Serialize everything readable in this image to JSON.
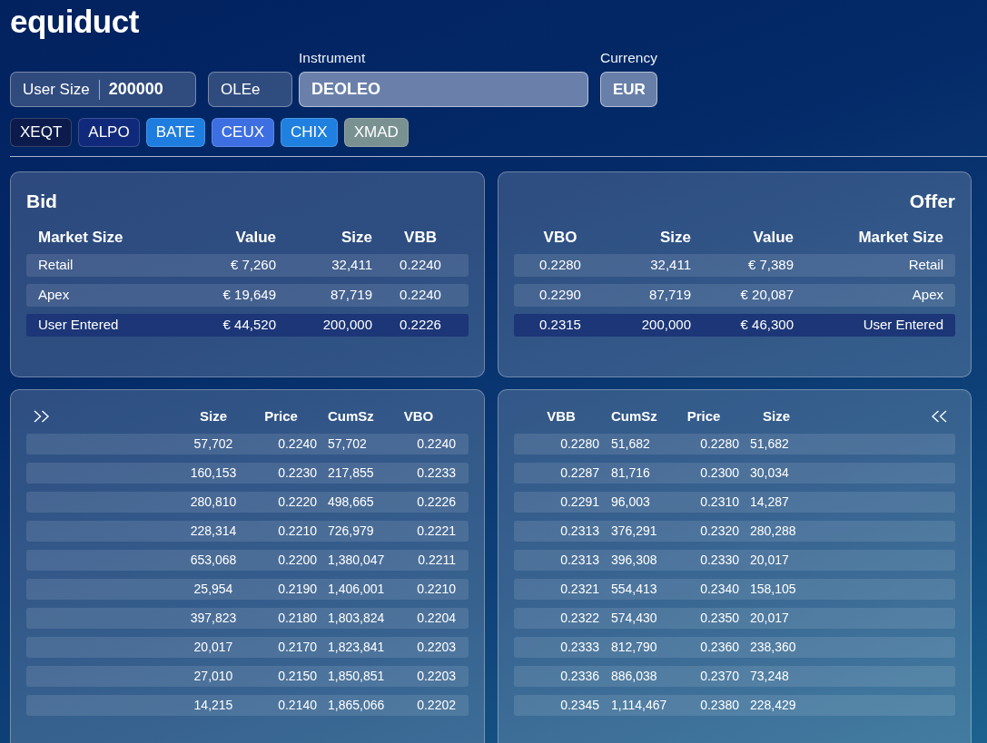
{
  "logo": {
    "text": "equiduct"
  },
  "order_inputs": {
    "user_size": {
      "label": "User Size",
      "value": "200000"
    },
    "symbol": {
      "value": "OLEe"
    },
    "instrument": {
      "label": "Instrument",
      "value": "DEOLEO"
    },
    "currency": {
      "label": "Currency",
      "value": "EUR"
    }
  },
  "venues": [
    {
      "label": "XEQT",
      "color": "#0c1b4b"
    },
    {
      "label": "ALPO",
      "color": "#10297b"
    },
    {
      "label": "BATE",
      "color": "#1f7de0"
    },
    {
      "label": "CEUX",
      "color": "#3d6fe2"
    },
    {
      "label": "CHIX",
      "color": "#1f80e0"
    },
    {
      "label": "XMAD",
      "color": "#7a9192"
    }
  ],
  "bid_summary": {
    "title": "Bid",
    "columns": [
      "Market Size",
      "Value",
      "Size",
      "VBB"
    ],
    "rows": [
      {
        "cells": [
          "Retail",
          "€ 7,260",
          "32,411",
          "0.2240"
        ],
        "highlighted": false
      },
      {
        "cells": [
          "Apex",
          "€ 19,649",
          "87,719",
          "0.2240"
        ],
        "highlighted": false
      },
      {
        "cells": [
          "User Entered",
          "€ 44,520",
          "200,000",
          "0.2226"
        ],
        "highlighted": true
      }
    ]
  },
  "offer_summary": {
    "title": "Offer",
    "columns": [
      "VBO",
      "Size",
      "Value",
      "Market Size"
    ],
    "rows": [
      {
        "cells": [
          "0.2280",
          "32,411",
          "€ 7,389",
          "Retail"
        ],
        "highlighted": false
      },
      {
        "cells": [
          "0.2290",
          "87,719",
          "€ 20,087",
          "Apex"
        ],
        "highlighted": false
      },
      {
        "cells": [
          "0.2315",
          "200,000",
          "€ 46,300",
          "User Entered"
        ],
        "highlighted": true
      }
    ]
  },
  "bid_depth": {
    "columns": [
      "Size",
      "Price",
      "CumSz",
      "VBO"
    ],
    "rows": [
      [
        "57,702",
        "0.2240",
        "57,702",
        "0.2240"
      ],
      [
        "160,153",
        "0.2230",
        "217,855",
        "0.2233"
      ],
      [
        "280,810",
        "0.2220",
        "498,665",
        "0.2226"
      ],
      [
        "228,314",
        "0.2210",
        "726,979",
        "0.2221"
      ],
      [
        "653,068",
        "0.2200",
        "1,380,047",
        "0.2211"
      ],
      [
        "25,954",
        "0.2190",
        "1,406,001",
        "0.2210"
      ],
      [
        "397,823",
        "0.2180",
        "1,803,824",
        "0.2204"
      ],
      [
        "20,017",
        "0.2170",
        "1,823,841",
        "0.2203"
      ],
      [
        "27,010",
        "0.2150",
        "1,850,851",
        "0.2203"
      ],
      [
        "14,215",
        "0.2140",
        "1,865,066",
        "0.2202"
      ]
    ]
  },
  "offer_depth": {
    "columns": [
      "VBB",
      "CumSz",
      "Price",
      "Size"
    ],
    "rows": [
      [
        "0.2280",
        "51,682",
        "0.2280",
        "51,682"
      ],
      [
        "0.2287",
        "81,716",
        "0.2300",
        "30,034"
      ],
      [
        "0.2291",
        "96,003",
        "0.2310",
        "14,287"
      ],
      [
        "0.2313",
        "376,291",
        "0.2320",
        "280,288"
      ],
      [
        "0.2313",
        "396,308",
        "0.2330",
        "20,017"
      ],
      [
        "0.2321",
        "554,413",
        "0.2340",
        "158,105"
      ],
      [
        "0.2322",
        "574,430",
        "0.2350",
        "20,017"
      ],
      [
        "0.2333",
        "812,790",
        "0.2360",
        "238,360"
      ],
      [
        "0.2336",
        "886,038",
        "0.2370",
        "73,248"
      ],
      [
        "0.2345",
        "1,114,467",
        "0.2380",
        "228,429"
      ]
    ]
  }
}
